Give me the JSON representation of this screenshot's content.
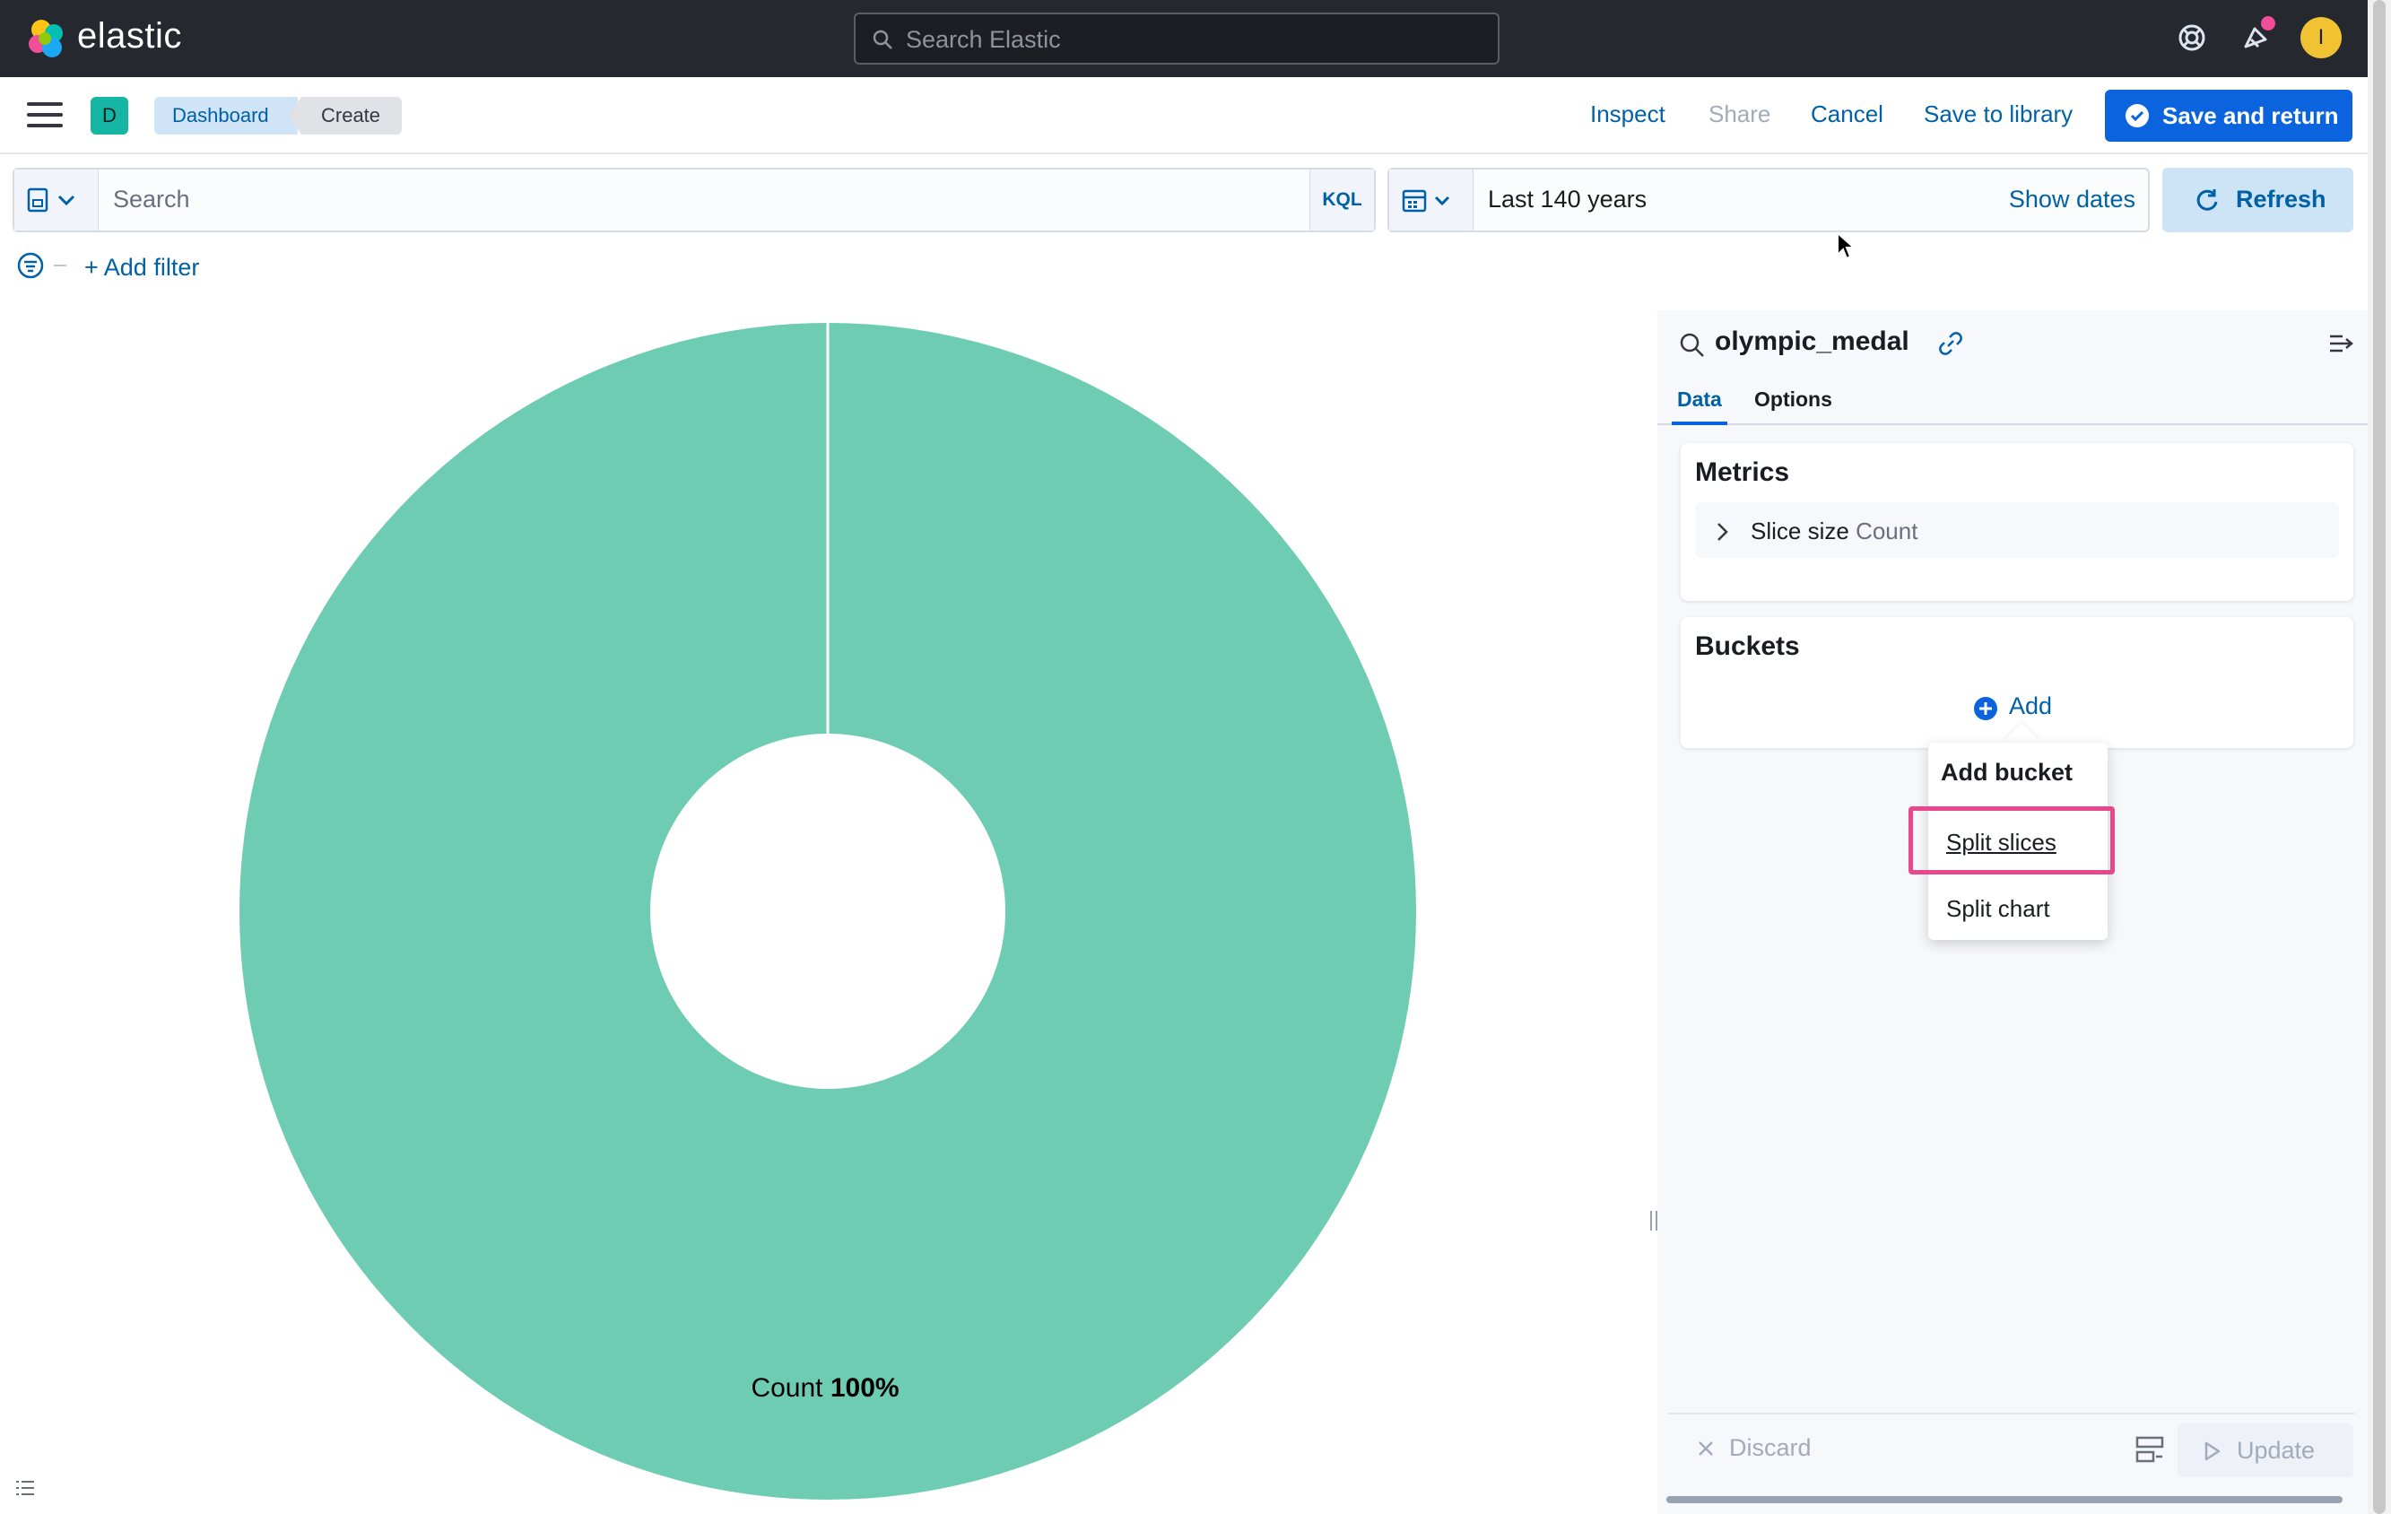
{
  "header": {
    "brand": "elastic",
    "search_placeholder": "Search Elastic",
    "avatar_initial": "I"
  },
  "appbar": {
    "space_initial": "D",
    "breadcrumbs": [
      "Dashboard",
      "Create"
    ],
    "links": {
      "inspect": "Inspect",
      "share": "Share",
      "cancel": "Cancel",
      "save_library": "Save to library"
    },
    "save_and_return": "Save and return"
  },
  "query": {
    "placeholder": "Search",
    "language": "KQL",
    "date_range": "Last 140 years",
    "show_dates": "Show dates",
    "refresh": "Refresh",
    "add_filter": "+ Add filter"
  },
  "chart_data": {
    "type": "pie",
    "donut": true,
    "categories": [
      "Count"
    ],
    "values": [
      100
    ],
    "label_name": "Count",
    "label_value": "100%",
    "colors": [
      "#6dccb1"
    ]
  },
  "sidebar": {
    "index_pattern": "olympic_medal",
    "tabs": [
      "Data",
      "Options"
    ],
    "metrics_title": "Metrics",
    "metric": {
      "name": "Slice size",
      "agg": "Count"
    },
    "buckets_title": "Buckets",
    "add_label": "Add",
    "popover": {
      "title": "Add bucket",
      "items": [
        "Split slices",
        "Split chart"
      ]
    },
    "footer": {
      "discard": "Discard",
      "update": "Update"
    }
  },
  "colors": {
    "accent": "#0b64dd",
    "highlight": "#e8488b",
    "slice": "#6dccb1"
  }
}
